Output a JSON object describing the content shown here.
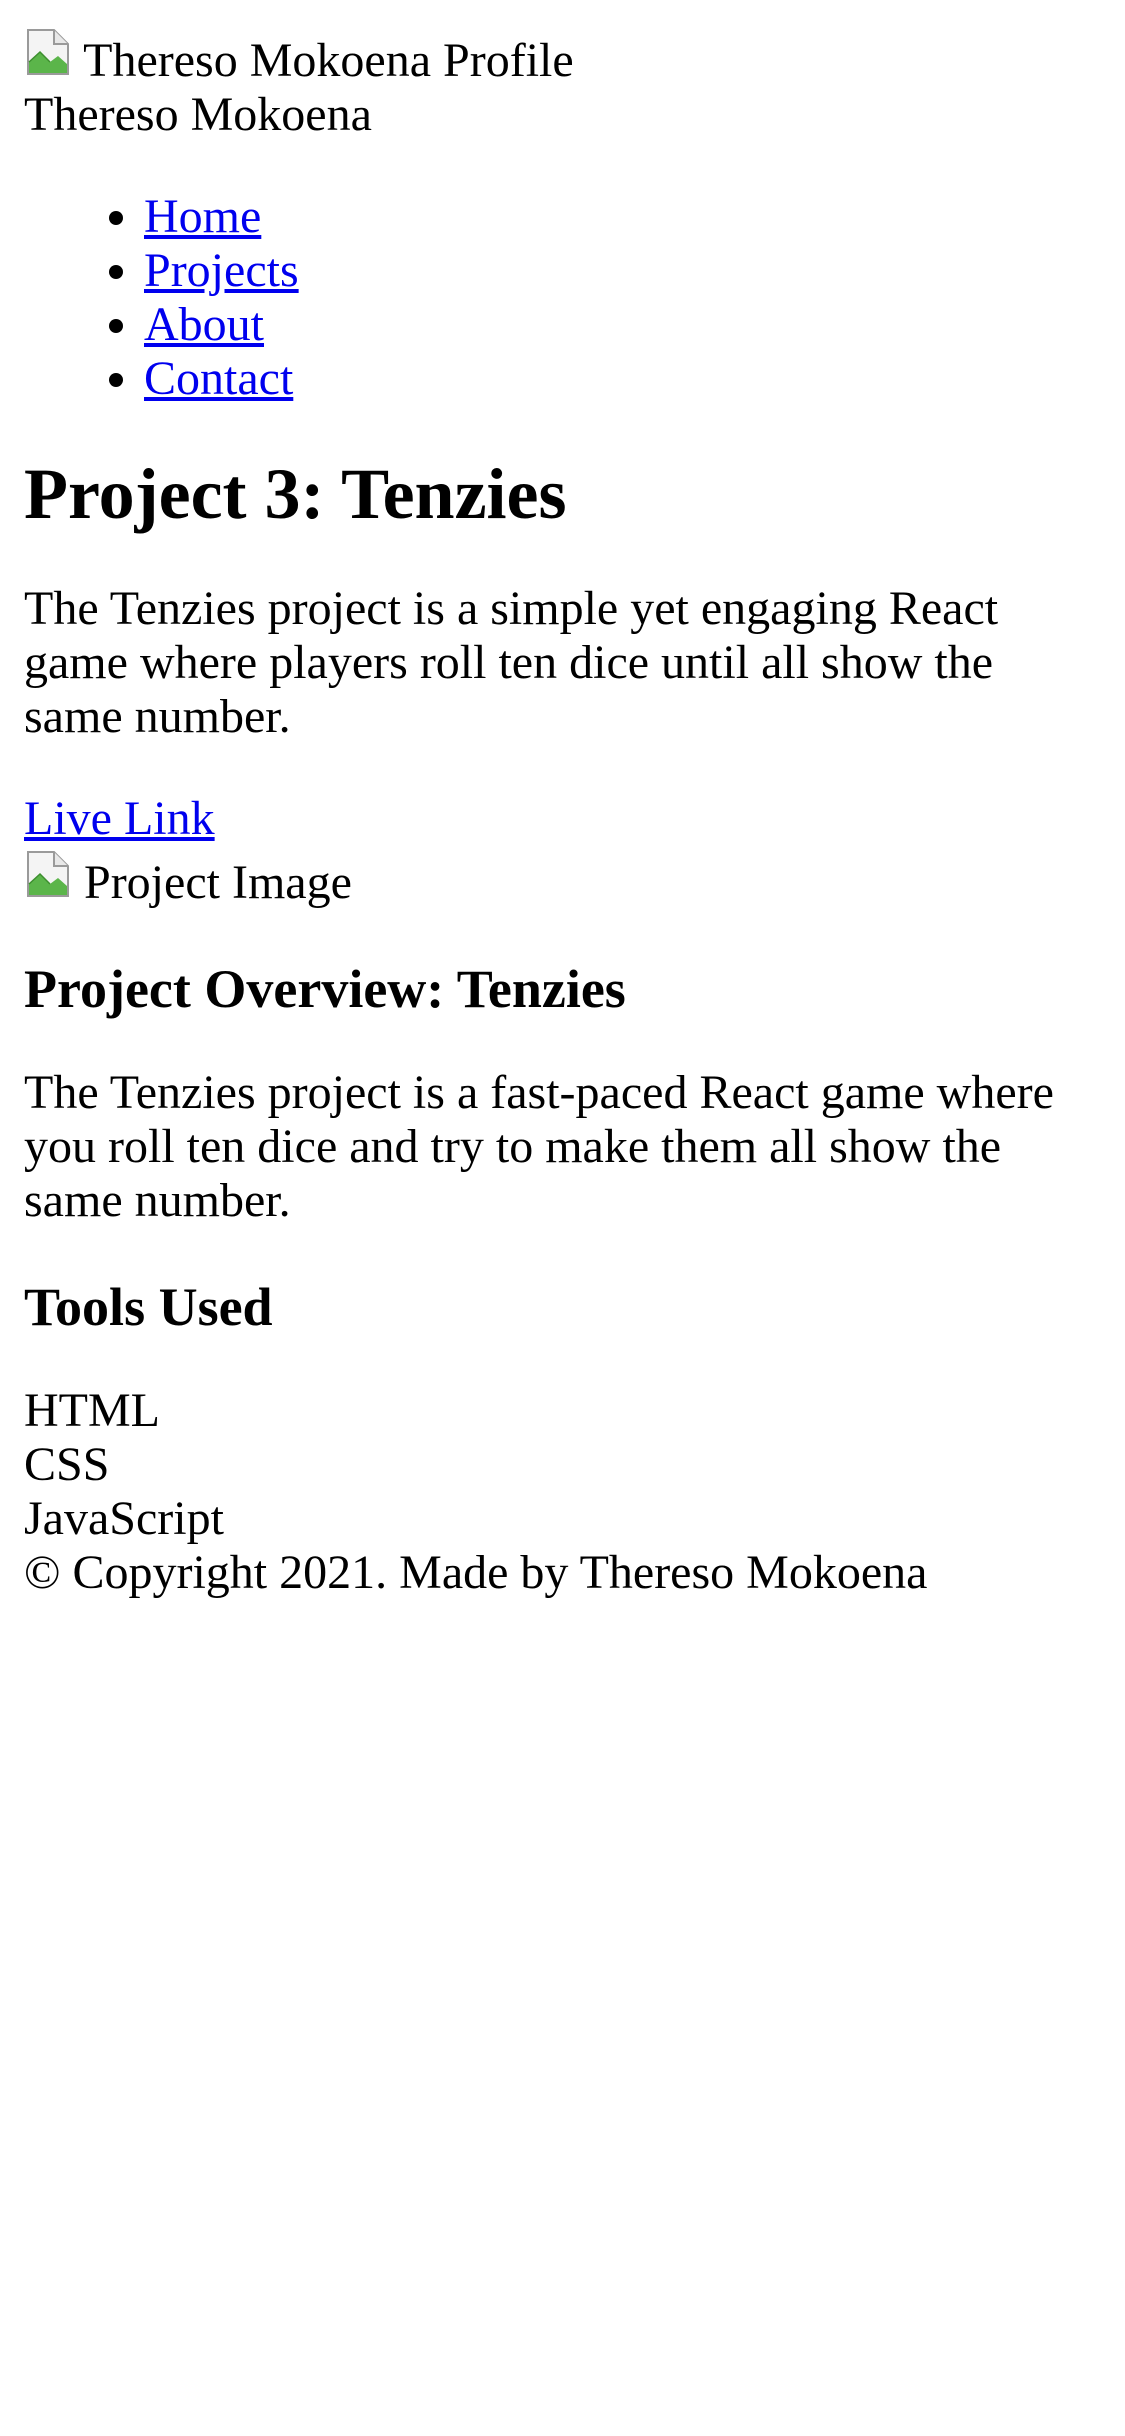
{
  "header": {
    "profile_image_alt": "Thereso Mokoena Profile",
    "name": "Thereso Mokoena"
  },
  "nav": {
    "items": [
      {
        "label": "Home"
      },
      {
        "label": "Projects"
      },
      {
        "label": "About"
      },
      {
        "label": "Contact"
      }
    ]
  },
  "project": {
    "title": "Project 3: Tenzies",
    "description": "The Tenzies project is a simple yet engaging React game where players roll ten dice until all show the same number.",
    "live_link_label": "Live Link",
    "image_alt": "Project Image"
  },
  "overview": {
    "heading": "Project Overview: Tenzies",
    "text": "The Tenzies project is a fast-paced React game where you roll ten dice and try to make them all show the same number."
  },
  "tools": {
    "heading": "Tools Used",
    "items": [
      "HTML",
      "CSS",
      "JavaScript"
    ]
  },
  "footer": {
    "copyright": "© Copyright 2021. Made by Thereso Mokoena"
  },
  "colors": {
    "link": "#0000ee",
    "text": "#000000",
    "background": "#ffffff"
  }
}
